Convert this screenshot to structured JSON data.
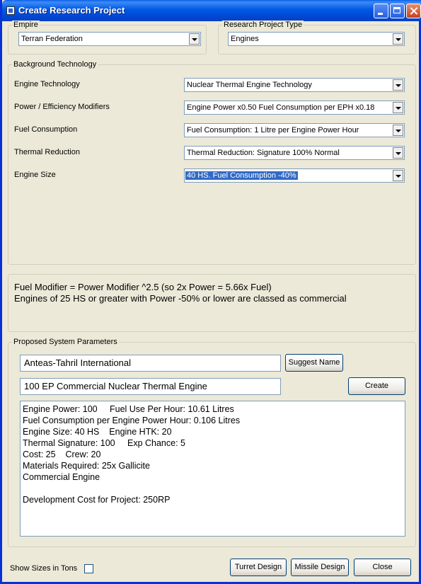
{
  "window": {
    "title": "Create Research Project"
  },
  "empire": {
    "legend": "Empire",
    "value": "Terran Federation"
  },
  "project_type": {
    "legend": "Research Project Type",
    "value": "Engines"
  },
  "background": {
    "legend": "Background Technology",
    "rows": [
      {
        "label": "Engine Technology",
        "value": "Nuclear Thermal Engine Technology"
      },
      {
        "label": "Power / Efficiency Modifiers",
        "value": "Engine Power x0.50  Fuel Consumption per EPH x0.18"
      },
      {
        "label": "Fuel Consumption",
        "value": "Fuel Consumption: 1 Litre per Engine Power Hour"
      },
      {
        "label": "Thermal Reduction",
        "value": "Thermal Reduction: Signature 100% Normal"
      },
      {
        "label": "Engine Size",
        "value": "40 HS.  Fuel Consumption -40%"
      }
    ]
  },
  "info": {
    "line1": "Fuel Modifier = Power Modifier ^2.5  (so 2x Power = 5.66x Fuel)",
    "line2": "Engines of 25 HS or greater with Power -50% or lower are classed as commercial"
  },
  "proposed": {
    "legend": "Proposed System Parameters",
    "company": "Anteas-Tahril International",
    "suggest_label": "Suggest Name",
    "name": "100 EP Commercial Nuclear Thermal Engine",
    "create_label": "Create",
    "details": [
      "Engine Power: 100     Fuel Use Per Hour: 10.61 Litres",
      "Fuel Consumption per Engine Power Hour: 0.106 Litres",
      "Engine Size: 40 HS    Engine HTK: 20",
      "Thermal Signature: 100     Exp Chance: 5",
      "Cost: 25    Crew: 20",
      "Materials Required: 25x Gallicite",
      "Commercial Engine",
      "",
      "Development Cost for Project: 250RP"
    ]
  },
  "footer": {
    "show_sizes_label": "Show Sizes in Tons",
    "show_sizes_checked": false,
    "turret_label": "Turret Design",
    "missile_label": "Missile Design",
    "close_label": "Close"
  }
}
